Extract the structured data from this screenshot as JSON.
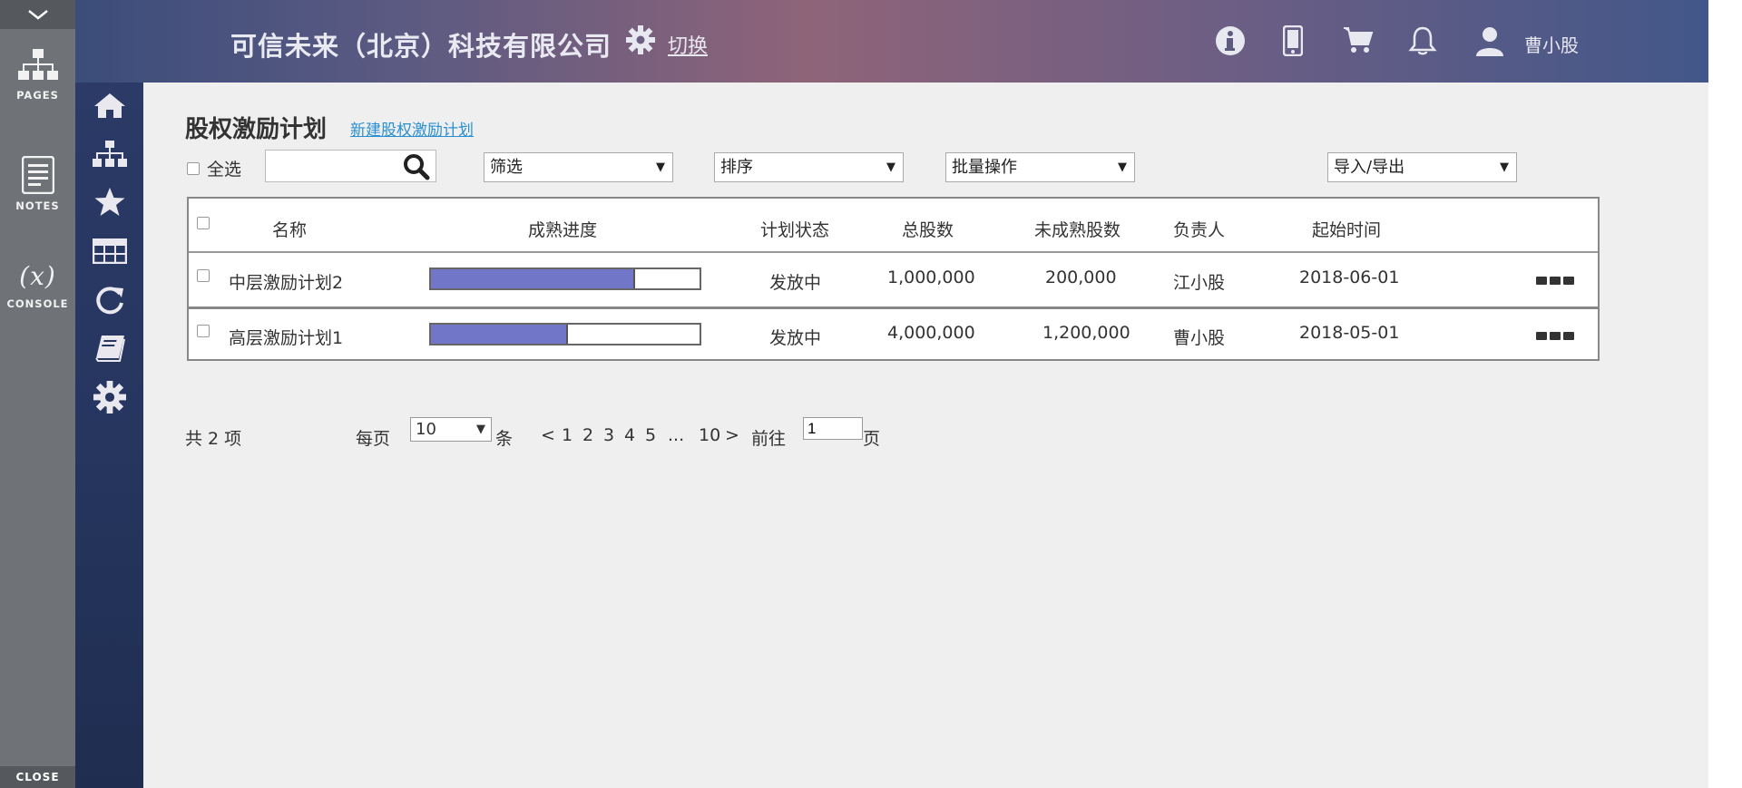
{
  "tool_panel": {
    "pages_label": "PAGES",
    "notes_label": "NOTES",
    "console_label": "CONSOLE",
    "console_symbol": "(x)",
    "close_label": "CLOSE"
  },
  "header": {
    "company_name": "可信未来（北京）科技有限公司",
    "switch_label": "切换",
    "user_name": "曹小股"
  },
  "page": {
    "title": "股权激励计划",
    "new_link": "新建股权激励计划"
  },
  "toolbar": {
    "select_all_label": "全选",
    "search_value": "",
    "filter_label": "筛选",
    "sort_label": "排序",
    "batch_label": "批量操作",
    "import_export_label": "导入/导出",
    "dropdown_arrow": "▼"
  },
  "table": {
    "columns": [
      "名称",
      "成熟进度",
      "计划状态",
      "总股数",
      "未成熟股数",
      "负责人",
      "起始时间"
    ],
    "rows": [
      {
        "name": "中层激励计划2",
        "progress": 0.76,
        "status": "发放中",
        "total_shares": "1,000,000",
        "unvested_shares": "200,000",
        "owner": "江小股",
        "start_date": "2018-06-01"
      },
      {
        "name": "高层激励计划1",
        "progress": 0.51,
        "status": "发放中",
        "total_shares": "4,000,000",
        "unvested_shares": "1,200,000",
        "owner": "曹小股",
        "start_date": "2018-05-01"
      }
    ]
  },
  "pagination": {
    "total_text": "共 2 项",
    "per_page_label": "每页",
    "per_page_value": "10",
    "per_page_unit": "条",
    "prev": "<",
    "pages": [
      "1",
      "2",
      "3",
      "4",
      "5"
    ],
    "ellipsis": "...",
    "last_page": "10",
    "next": ">",
    "goto_label": "前往",
    "goto_value": "1",
    "goto_unit": "页"
  },
  "colors": {
    "progress_fill": "#7276c8",
    "link": "#2a8fd0",
    "main_bg": "#efefef"
  }
}
